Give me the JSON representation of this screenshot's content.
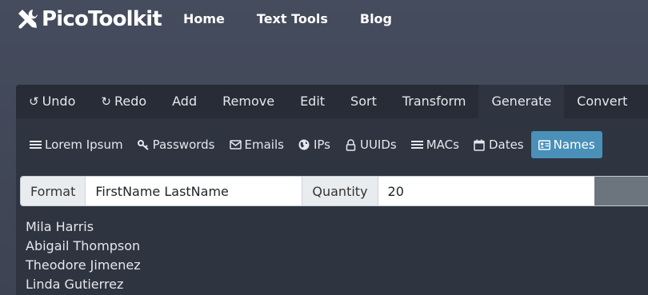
{
  "header": {
    "logo_text": "PicoToolkit",
    "nav": [
      "Home",
      "Text Tools",
      "Blog"
    ]
  },
  "tabs": [
    {
      "label": "Undo",
      "icon": "undo-icon"
    },
    {
      "label": "Redo",
      "icon": "redo-icon"
    },
    {
      "label": "Add"
    },
    {
      "label": "Remove"
    },
    {
      "label": "Edit"
    },
    {
      "label": "Sort"
    },
    {
      "label": "Transform"
    },
    {
      "label": "Generate",
      "active": true
    },
    {
      "label": "Convert"
    }
  ],
  "subtabs": [
    {
      "label": "Lorem Ipsum",
      "icon": "list-icon"
    },
    {
      "label": "Passwords",
      "icon": "key-icon"
    },
    {
      "label": "Emails",
      "icon": "envelope-icon"
    },
    {
      "label": "IPs",
      "icon": "globe-icon"
    },
    {
      "label": "UUIDs",
      "icon": "lock-icon"
    },
    {
      "label": "MACs",
      "icon": "list-icon"
    },
    {
      "label": "Dates",
      "icon": "calendar-icon"
    },
    {
      "label": "Names",
      "icon": "id-card-icon",
      "active": true
    }
  ],
  "form": {
    "format_label": "Format",
    "format_value": "FirstName LastName",
    "quantity_label": "Quantity",
    "quantity_value": "20"
  },
  "output": [
    "Mila Harris",
    "Abigail Thompson",
    "Theodore Jimenez",
    "Linda Gutierrez"
  ],
  "colors": {
    "active_subtab": "#4a90b8",
    "tab_bar": "#272c36",
    "panel": "#2e3440"
  }
}
